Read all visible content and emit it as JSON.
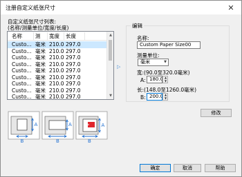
{
  "window": {
    "title": "注册自定义纸张尺寸"
  },
  "list": {
    "label_line1": "自定义纸张尺寸列表:",
    "label_line2": "(名称/测量单位/宽度/长度)",
    "headers": [
      "名称",
      "测",
      "宽度",
      "长度"
    ],
    "rows": [
      [
        "Custo...",
        "毫米",
        "210.0",
        "297.0"
      ],
      [
        "Custo...",
        "毫米",
        "210.0",
        "297.0"
      ],
      [
        "Custo...",
        "毫米",
        "210.0",
        "297.0"
      ],
      [
        "Custo...",
        "毫米",
        "210.0",
        "297.0"
      ],
      [
        "Custo...",
        "毫米",
        "210.0",
        "297.0"
      ],
      [
        "Custo...",
        "毫米",
        "210.0",
        "297.0"
      ],
      [
        "Custo...",
        "毫米",
        "210.0",
        "297.0"
      ],
      [
        "Custo...",
        "毫米",
        "210.0",
        "297.0"
      ],
      [
        "Custo...",
        "毫米",
        "210.0",
        "297.0"
      ]
    ],
    "selected_index": 0
  },
  "edit": {
    "group_label": "编辑",
    "name_label": "名称:",
    "name_value": "Custom Paper Size00",
    "unit_label": "测量单位:",
    "unit_value": "毫米",
    "width_label": "宽:(90.0至320.0毫米)",
    "width_prefix": "A:",
    "width_value": "180.0",
    "length_label": "长:(148.0至1260.0毫米)",
    "length_prefix": "B:",
    "length_value": "200.0"
  },
  "illustration": {
    "label_a": "A",
    "label_b": "B"
  },
  "buttons": {
    "modify": "修改",
    "ok": "确定",
    "cancel": "取消",
    "help": "帮助"
  },
  "icons": {
    "close": "close-icon",
    "arrow": "arrow-right-icon"
  },
  "colors": {
    "accent": "#0078d7",
    "selection": "#cce8ff",
    "illustration_blue": "#1f6fd1",
    "illustration_red": "#e0262d"
  }
}
